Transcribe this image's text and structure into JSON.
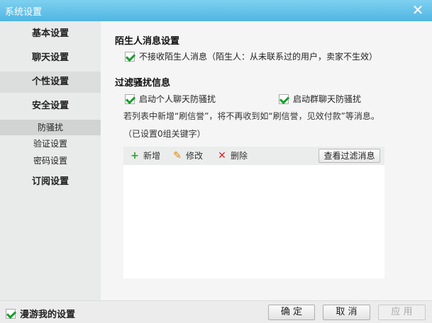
{
  "window": {
    "title": "系统设置"
  },
  "sidebar": {
    "items": [
      {
        "label": "基本设置"
      },
      {
        "label": "聊天设置"
      },
      {
        "label": "个性设置"
      },
      {
        "label": "安全设置"
      }
    ],
    "sub_items": [
      {
        "label": "防骚扰"
      },
      {
        "label": "验证设置"
      },
      {
        "label": "密码设置"
      }
    ],
    "last_item": {
      "label": "订阅设置"
    }
  },
  "stranger": {
    "title": "陌生人消息设置",
    "reject_label": "不接收陌生人消息（陌生人：从未联系过的用户，卖家不生效）",
    "reject_checked": true
  },
  "filter": {
    "title": "过滤骚扰信息",
    "personal_label": "启动个人聊天防骚扰",
    "personal_checked": true,
    "group_label": "启动群聊天防骚扰",
    "group_checked": true,
    "note": "若列表中新增“刷信誉”，将不再收到如“刷信誉，见效付款”等消息。",
    "count_note": "（已设置0组关键字）",
    "toolbar": {
      "add_label": "新增",
      "edit_label": "修改",
      "delete_label": "删除",
      "view_label": "查看过滤消息"
    }
  },
  "footer": {
    "roam_label": "漫游我的设置",
    "roam_checked": true,
    "ok_label": "确 定",
    "cancel_label": "取 消",
    "apply_label": "应 用"
  },
  "colors": {
    "titlebar": "#4fb6e3",
    "check": "#1a9c2e",
    "add_icon": "#2e9e2e",
    "edit_icon": "#e08a00",
    "delete_icon": "#d22"
  }
}
